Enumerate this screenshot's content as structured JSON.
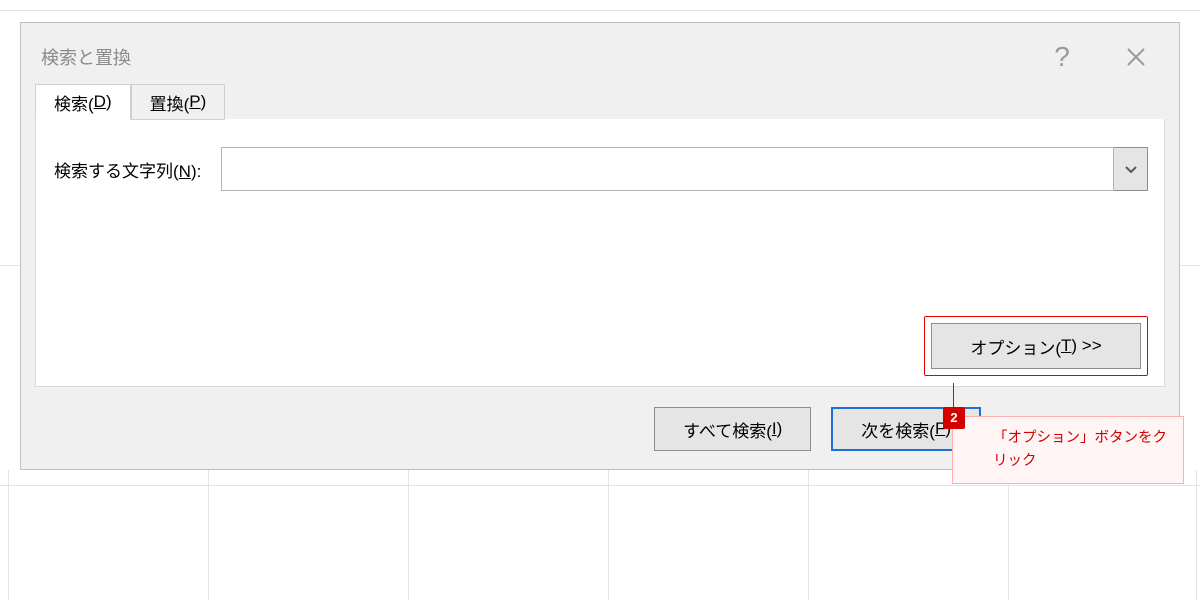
{
  "dialog": {
    "title": "検索と置換",
    "tabs": {
      "find": {
        "label_pre": "検索(",
        "label_access": "D",
        "label_post": ")"
      },
      "replace": {
        "label_pre": "置換(",
        "label_access": "P",
        "label_post": ")"
      }
    },
    "field": {
      "label_pre": "検索する文字列(",
      "label_access": "N",
      "label_post": "):",
      "value": ""
    },
    "options": {
      "label_pre": "オプション(",
      "label_access": "T",
      "label_post": ") >>"
    },
    "buttons": {
      "find_all": {
        "label_pre": "すべて検索(",
        "label_access": "I",
        "label_post": ")"
      },
      "find_next": {
        "label_pre": "次を検索(",
        "label_access": "F",
        "label_post": ")"
      },
      "close": {
        "label": "閉じる"
      }
    }
  },
  "callout": {
    "badge": "2",
    "text": "「オプション」ボタンをクリック"
  }
}
